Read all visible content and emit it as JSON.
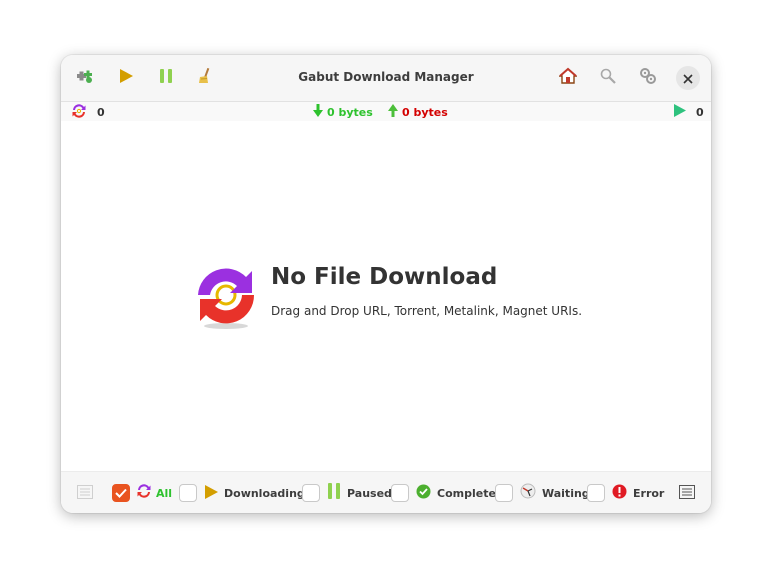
{
  "window": {
    "title": "Gabut Download Manager"
  },
  "toolbar": {
    "left_icons": [
      "add-download-icon",
      "play-icon",
      "pause-icon",
      "broom-icon"
    ],
    "right_icons": [
      "home-icon",
      "search-icon",
      "settings-icon",
      "close-icon"
    ]
  },
  "status": {
    "active_count": "0",
    "download_speed": "0 bytes",
    "upload_speed": "0 bytes",
    "running_count": "0"
  },
  "empty_state": {
    "title": "No File Download",
    "subtitle": "Drag and Drop URL, Torrent, Metalink, Magnet URIs."
  },
  "filters": {
    "all": "All",
    "downloading": "Downloading",
    "paused": "Paused",
    "complete": "Complete",
    "waiting": "Waiting",
    "error": "Error"
  },
  "colors": {
    "accent": "#e95420",
    "download_green": "#2ec22e",
    "upload_red": "#d40000",
    "all_green": "#2ec22e"
  }
}
